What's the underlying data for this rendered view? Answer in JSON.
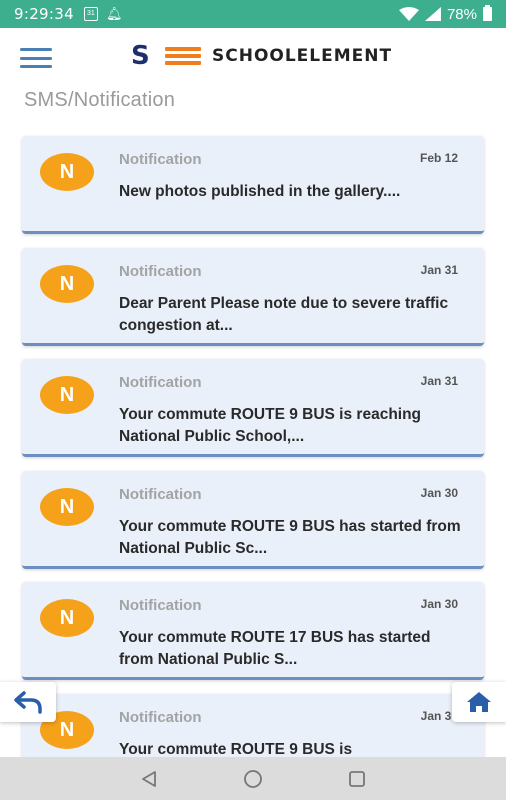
{
  "status_bar": {
    "time": "9:29:34",
    "calendar_day": "31",
    "battery": "78%"
  },
  "header": {
    "brand": "SCHOOLELEMENT",
    "logo_mark": "SE"
  },
  "page": {
    "title": "SMS/Notification"
  },
  "notifications": [
    {
      "avatar": "N",
      "type": "Notification",
      "date": "Feb 12",
      "message": "New photos published in the gallery...."
    },
    {
      "avatar": "N",
      "type": "Notification",
      "date": "Jan 31",
      "message": "Dear Parent Please note due to severe traffic congestion at..."
    },
    {
      "avatar": "N",
      "type": "Notification",
      "date": "Jan 31",
      "message": "Your commute ROUTE 9 BUS is reaching National Public School,..."
    },
    {
      "avatar": "N",
      "type": "Notification",
      "date": "Jan 30",
      "message": "Your commute ROUTE 9 BUS has started from National Public Sc..."
    },
    {
      "avatar": "N",
      "type": "Notification",
      "date": "Jan 30",
      "message": "Your commute ROUTE 17 BUS has started from National Public S..."
    },
    {
      "avatar": "N",
      "type": "Notification",
      "date": "Jan 30",
      "message": "Your commute ROUTE 9 BUS is"
    }
  ],
  "icons": {
    "menu": "hamburger-menu-icon",
    "back": "back-arrow-icon",
    "home": "home-icon",
    "nav_back": "triangle-back-icon",
    "nav_home": "circle-home-icon",
    "nav_recent": "square-recents-icon"
  },
  "colors": {
    "status_bar": "#3daf8f",
    "avatar": "#f5a11a",
    "card_bg": "#eaf0f9",
    "card_border": "#6c8ec0",
    "brand_navy": "#1d2f6e",
    "brand_orange": "#f07d1e"
  }
}
